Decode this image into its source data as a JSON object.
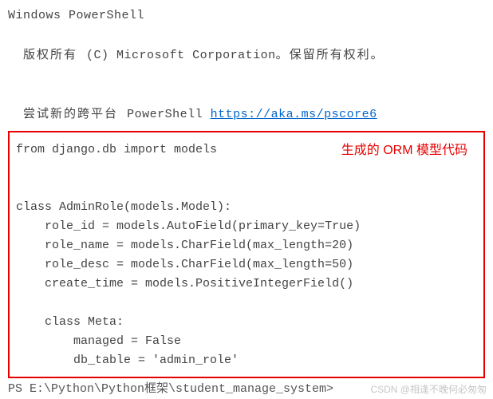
{
  "header": {
    "line1": "Windows PowerShell",
    "copyright_prefix": "版权所有 ",
    "copyright_mid": "(C) Microsoft Corporation",
    "copyright_suffix": "。保留所有权利。",
    "try_prefix": "尝试新的跨平台 ",
    "try_mid": "PowerShell ",
    "link_text": "https://aka.ms/pscore6",
    "link_href": "https://aka.ms/pscore6"
  },
  "annotation": "生成的 ORM 模型代码",
  "code": {
    "l1": "from django.db import models",
    "l2": "class AdminRole(models.Model):",
    "l3": "    role_id = models.AutoField(primary_key=True)",
    "l4": "    role_name = models.CharField(max_length=20)",
    "l5": "    role_desc = models.CharField(max_length=50)",
    "l6": "    create_time = models.PositiveIntegerField()",
    "l7": "    class Meta:",
    "l8": "        managed = False",
    "l9": "        db_table = 'admin_role'"
  },
  "prompt": "PS E:\\Python\\Python框架\\student_manage_system>",
  "watermark": "CSDN @相逢不晚何必匆匆"
}
